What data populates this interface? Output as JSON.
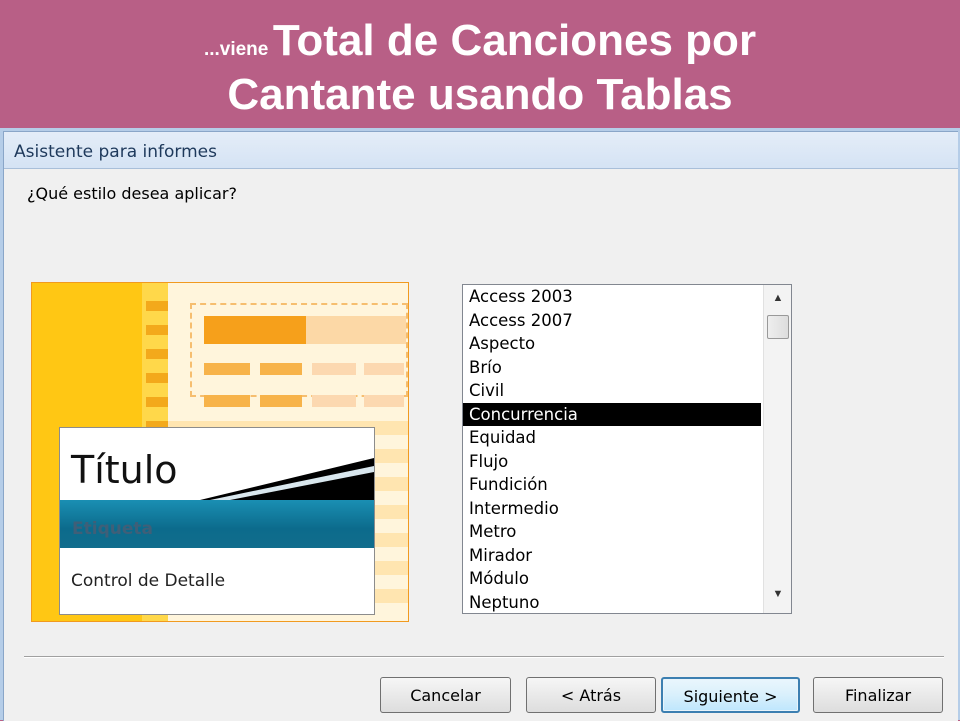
{
  "slide": {
    "title_prefix": "...viene",
    "title_main": "Total de Canciones por",
    "title_line2": "Cantante usando Tablas"
  },
  "dialog": {
    "title": "Asistente para informes",
    "question": "¿Qué estilo desea aplicar?",
    "preview": {
      "sample_title": "Título",
      "sample_label": "Etiqueta",
      "sample_detail": "Control de Detalle"
    },
    "styles": {
      "items": [
        "Access 2003",
        "Access 2007",
        "Aspecto",
        "Brío",
        "Civil",
        "Concurrencia",
        "Equidad",
        "Flujo",
        "Fundición",
        "Intermedio",
        "Metro",
        "Mirador",
        "Módulo",
        "Neptuno"
      ],
      "selected": "Concurrencia"
    },
    "buttons": {
      "cancel": "Cancelar",
      "back": "< Atrás",
      "next": "Siguiente >",
      "finish": "Finalizar"
    }
  },
  "colors": {
    "banner": "#b85f86",
    "selection": "#000000",
    "preview_accent": "#f6a01b",
    "label_bar": "#0c6b8c"
  }
}
